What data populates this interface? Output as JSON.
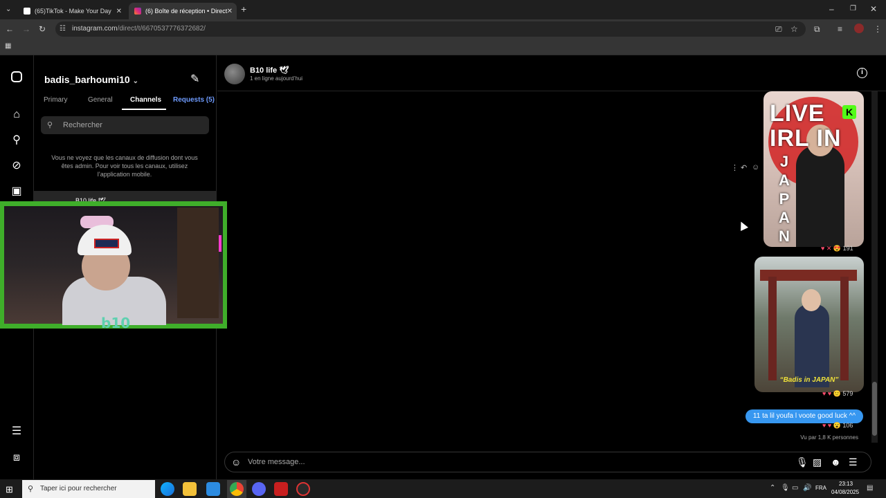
{
  "browser": {
    "tabs": [
      {
        "title": "(65)TikTok - Make Your Day",
        "favicon_color": "#ffffff"
      },
      {
        "title": "(6) Boîte de réception • Direct",
        "favicon_color": "#e1306c"
      }
    ],
    "url": {
      "host": "instagram.com",
      "path": "/direct/t/6670537776372682/"
    }
  },
  "inbox": {
    "username": "badis_barhoumi10",
    "tabs": [
      "Primary",
      "General",
      "Channels",
      "Requests (5)"
    ],
    "active_tab": "Channels",
    "search_placeholder": "Rechercher",
    "notice": "Vous ne voyez que les canaux de diffusion dont vous êtes admin. Pour voir tous les canaux, utilisez l’application mobile.",
    "channel": {
      "name": "B10 life",
      "emoji": "🕊"
    }
  },
  "webcam": {
    "mark": "b10"
  },
  "conversation": {
    "name": "B10 life",
    "name_emoji": "🕊",
    "status": "1 en ligne aujourd’hui",
    "image1": {
      "overlay_lines": [
        "LIVE",
        "IRL IN"
      ],
      "vertical_text": "JAPAN",
      "badge": "K",
      "reactions": "♥ ✕ 😍",
      "reaction_count": "191"
    },
    "image2": {
      "caption": "“Badis in JAPAN”",
      "reactions": "♥ ♥ 🙂",
      "reaction_count": "579"
    },
    "message": {
      "text": "11 ta lil youfa l voote good luck ^^",
      "reactions": "♥ ♥ 😮",
      "reaction_count": "106"
    },
    "seen": "Vu par 1,8 K personnes"
  },
  "composer": {
    "placeholder": "Votre message..."
  },
  "taskbar": {
    "search_placeholder": "Taper ici pour rechercher",
    "language": "FRA",
    "time": "23:13",
    "date": "04/08/2025"
  },
  "colors": {
    "accent": "#3797f0",
    "requests": "#6f9cff",
    "webcam_frame": "#3fae2a",
    "kick": "#53fc18"
  }
}
